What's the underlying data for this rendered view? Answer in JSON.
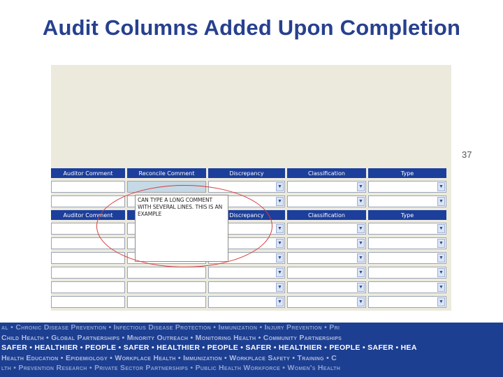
{
  "slide": {
    "title": "Audit Columns Added Upon Completion"
  },
  "grid": {
    "headers": [
      "Auditor Comment",
      "Reconcile Comment",
      "Discrepancy",
      "Classification",
      "Type"
    ],
    "headers2": [
      "Auditor Comment",
      "",
      "Discrepancy",
      "Classification",
      "Type"
    ]
  },
  "popup": {
    "text": "CAN TYPE A LONG COMMENT WITH SEVERAL LINES. THIS IS AN EXAMPLE"
  },
  "banner": {
    "lines": [
      "al • Chronic Disease Prevention • Infectious Disease Protection • Immunization • Injury Prevention • Pri",
      "Child Health • Global Partnerships • Minority Outreach • Monitoring Health • Community Partnerships",
      "SAFER • HEALTHIER • PEOPLE • SAFER • HEALTHIER • PEOPLE • SAFER • HEALTHIER • PEOPLE • SAFER • HEA",
      "Health Education • Epidemiology • Workplace Health • Immunization • Workplace Safety • Training • C",
      "lth • Prevention Research • Private Sector Partnerships • Public Health Workforce • Women's Health"
    ]
  },
  "page_number": "37"
}
